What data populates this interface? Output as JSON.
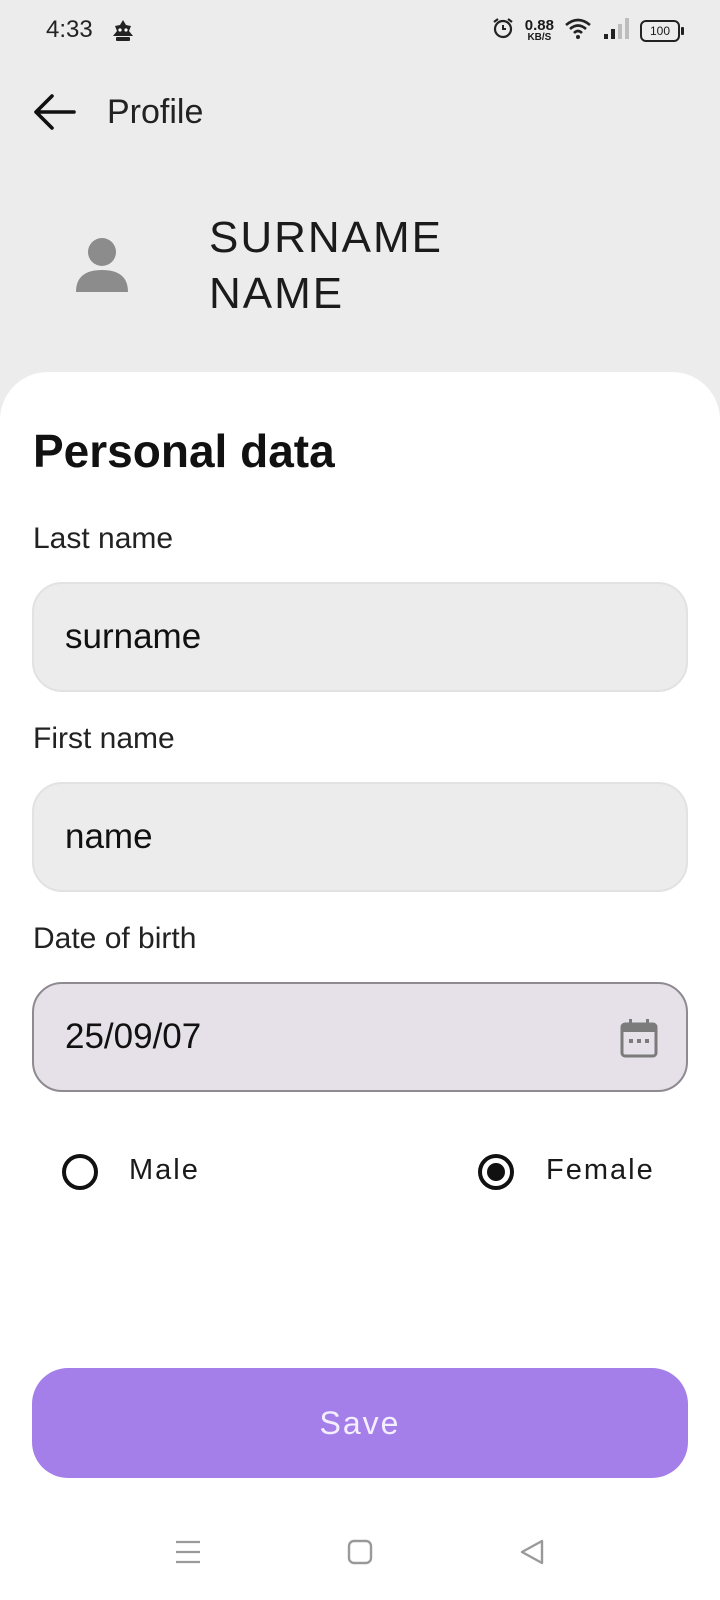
{
  "status_bar": {
    "time": "4:33",
    "net_speed_value": "0.88",
    "net_speed_unit": "KB/S",
    "battery": "100"
  },
  "header": {
    "title": "Profile"
  },
  "profile": {
    "surname": "SURNAME",
    "name": "NAME"
  },
  "form": {
    "section_title": "Personal data",
    "last_name": {
      "label": "Last name",
      "value": "surname"
    },
    "first_name": {
      "label": "First name",
      "value": "name"
    },
    "date_of_birth": {
      "label": "Date of birth",
      "value": "25/09/07"
    },
    "gender": {
      "options": [
        "Male",
        "Female"
      ],
      "selected": "Female"
    },
    "save_label": "Save"
  },
  "colors": {
    "accent": "#a57fe9",
    "sheet": "#ffffff",
    "background": "#ececec",
    "field": "#ececec",
    "date_field": "#e6e0e8"
  }
}
